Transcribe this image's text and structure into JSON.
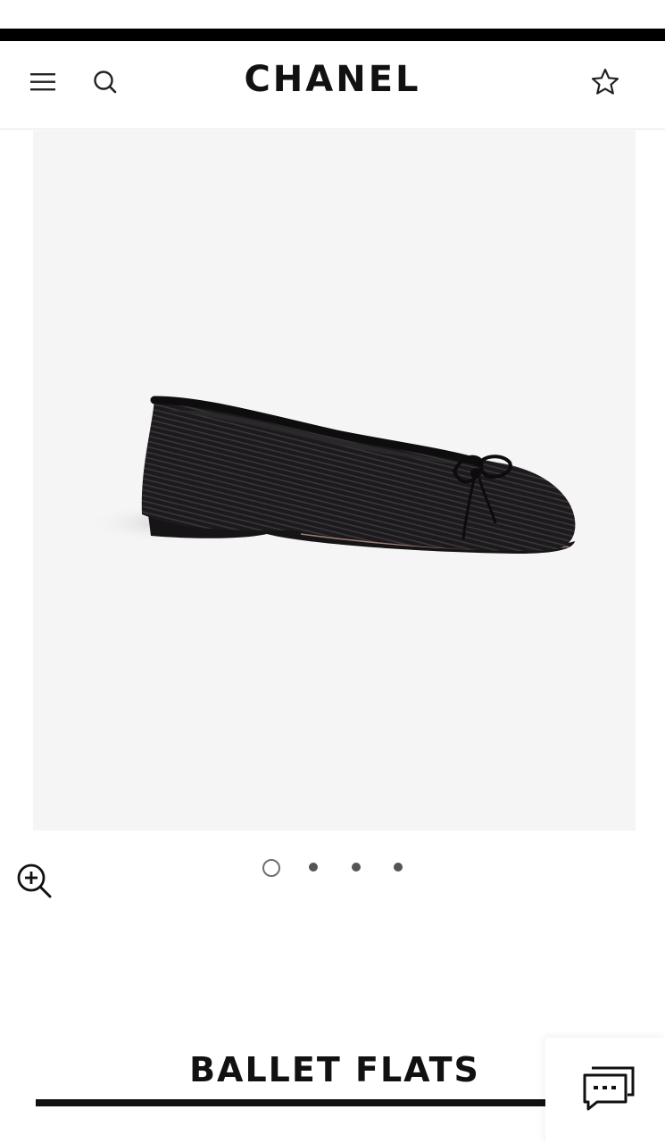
{
  "header": {
    "brand": "CHANEL",
    "menu_icon": "hamburger-menu-icon",
    "search_icon": "search-icon",
    "wishlist_icon": "star-icon"
  },
  "product": {
    "image_alt": "black ribbed ballet flat with bow",
    "title": "BALLET FLATS",
    "zoom_icon": "zoom-in-icon"
  },
  "carousel": {
    "total": 4,
    "active_index": 0
  },
  "chat": {
    "icon": "chat-bubbles-icon"
  },
  "colors": {
    "accent": "#000000",
    "image_bg": "#f5f5f5",
    "shoe": "#1c1a1c"
  }
}
